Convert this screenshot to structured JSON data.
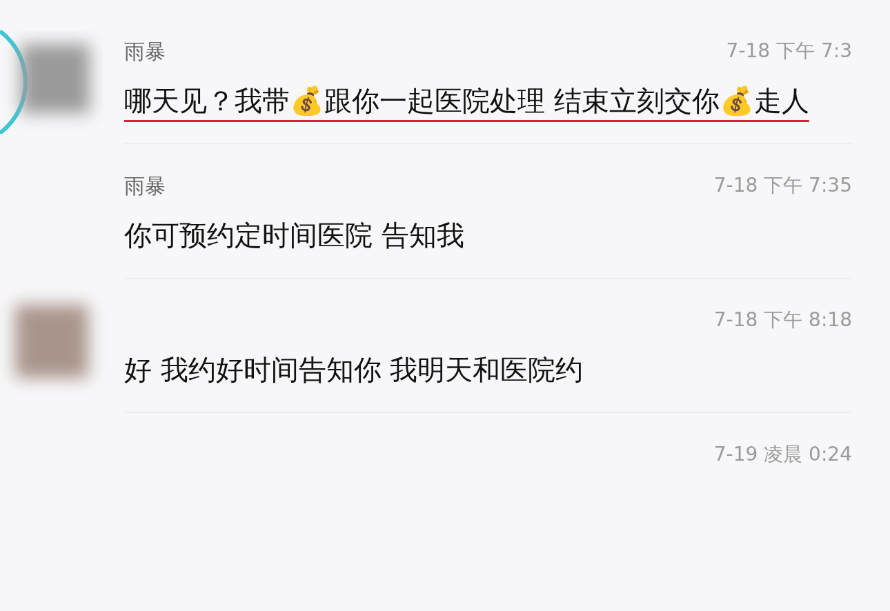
{
  "messages": [
    {
      "kind": "ring",
      "name": "雨暴",
      "time": "7-18 下午 7:3",
      "text": "哪天见？我带💰跟你一起医院处理 结束立刻交你💰走人",
      "underlined": true
    },
    {
      "kind": "plain",
      "name": "雨暴",
      "time": "7-18 下午 7:35",
      "text": "你可预约定时间医院 告知我",
      "underlined": false
    },
    {
      "kind": "photo",
      "time": "7-18 下午 8:18",
      "text": "好 我约好时间告知你 我明天和医院约",
      "underlined": false
    },
    {
      "kind": "plain",
      "time": "7-19 凌晨 0:24"
    }
  ]
}
